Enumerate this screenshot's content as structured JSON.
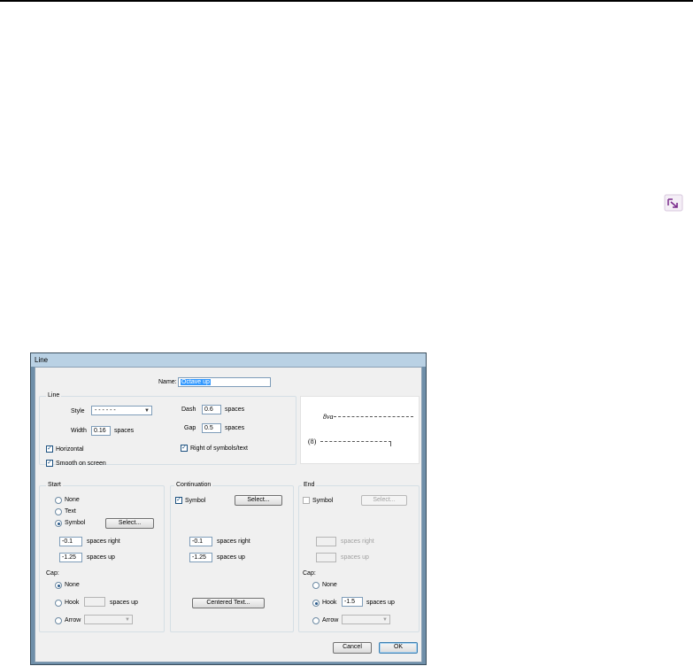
{
  "launcher": {
    "icon": "dialog-launcher-icon"
  },
  "dialog": {
    "title": "Line",
    "name_label": "Name:",
    "name_value": "Octave up",
    "line_group": {
      "title": "Line",
      "style_label": "Style",
      "style_value": "- - - - - -",
      "width_label": "Width",
      "width_value": "0.16",
      "width_unit": "spaces",
      "dash_label": "Dash",
      "dash_value": "0.6",
      "dash_unit": "spaces",
      "gap_label": "Gap",
      "gap_value": "0.5",
      "gap_unit": "spaces",
      "horizontal_label": "Horizontal",
      "horizontal_checked": true,
      "smooth_label": "Smooth on screen",
      "smooth_checked": true,
      "right_of_symbols_label": "Right of symbols/text",
      "right_of_symbols_checked": true
    },
    "preview": {
      "top_text": "8va",
      "bottom_text": "(8)"
    },
    "start": {
      "title": "Start",
      "none_label": "None",
      "text_label": "Text",
      "symbol_label": "Symbol",
      "selected": "Symbol",
      "select_button": "Select...",
      "right_value": "-0.1",
      "right_label": "spaces right",
      "up_value": "-1.25",
      "up_label": "spaces up",
      "cap_label": "Cap:",
      "cap_none": "None",
      "cap_hook": "Hook",
      "cap_hook_value": "",
      "cap_hook_unit": "spaces up",
      "cap_arrow": "Arrow",
      "cap_selected": "None"
    },
    "continuation": {
      "title": "Continuation",
      "symbol_label": "Symbol",
      "symbol_checked": true,
      "select_button": "Select...",
      "right_value": "-0.1",
      "right_label": "spaces right",
      "up_value": "-1.25",
      "up_label": "spaces up",
      "centered_text_button": "Centered Text..."
    },
    "end": {
      "title": "End",
      "symbol_label": "Symbol",
      "symbol_checked": false,
      "select_button": "Select...",
      "right_value": "",
      "right_label": "spaces right",
      "up_value": "",
      "up_label": "spaces up",
      "cap_label": "Cap:",
      "cap_none": "None",
      "cap_hook": "Hook",
      "cap_hook_value": "-1.5",
      "cap_hook_unit": "spaces up",
      "cap_arrow": "Arrow",
      "cap_selected": "Hook"
    },
    "buttons": {
      "cancel": "Cancel",
      "ok": "OK"
    },
    "colors": {
      "accent": "#3399ff",
      "title_bar": "#b9d1e4",
      "launcher_icon": "#7a2c8c"
    }
  }
}
